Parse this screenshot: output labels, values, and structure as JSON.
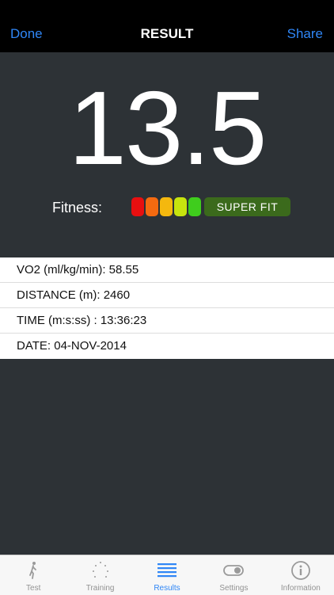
{
  "nav": {
    "left": "Done",
    "title": "RESULT",
    "right": "Share"
  },
  "result": {
    "score": "13.5",
    "fitness_label": "Fitness:",
    "fitness_level": "SUPER FIT",
    "meter_colors": [
      "#e80f10",
      "#f56a10",
      "#f4b80e",
      "#c7e40e",
      "#3fcd1d"
    ]
  },
  "details": [
    "VO2 (ml/kg/min): 58.55",
    "DISTANCE (m): 2460",
    "TIME (m:s:ss) : 13:36:23",
    "DATE: 04-NOV-2014"
  ],
  "tabs": [
    {
      "label": "Test",
      "icon": "runner-icon"
    },
    {
      "label": "Training",
      "icon": "dots-icon"
    },
    {
      "label": "Results",
      "icon": "list-icon"
    },
    {
      "label": "Settings",
      "icon": "toggle-icon"
    },
    {
      "label": "Information",
      "icon": "info-icon"
    }
  ],
  "colors": {
    "accent": "#2f86f6",
    "badge": "#3b6a1c",
    "background": "#2d3236"
  }
}
